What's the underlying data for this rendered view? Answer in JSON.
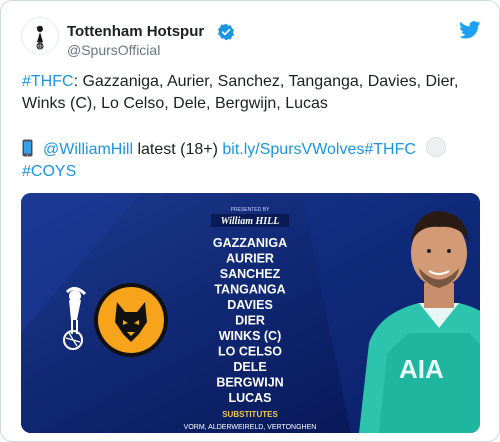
{
  "account": {
    "name": "Tottenham Hotspur",
    "handle": "@SpursOfficial"
  },
  "tweet": {
    "hashtag1": "#THFC",
    "text1": ": Gazzaniga, Aurier, Sanchez, Tanganga, Davies, Dier, Winks (C), Lo Celso, Dele, Bergwijn, Lucas",
    "mention": "@WilliamHill",
    "text2": " latest (18+) ",
    "url": "bit.ly/SpursVWolves",
    "hashtag2": "#THFC",
    "hashtag3": "#COYS"
  },
  "graphic": {
    "sponsor_small": "PRESENTED BY",
    "sponsor": "William HILL",
    "lineup": [
      "GAZZANIGA",
      "AURIER",
      "SANCHEZ",
      "TANGANGA",
      "DAVIES",
      "DIER",
      "WINKS (C)",
      "LO CELSO",
      "DELE",
      "BERGWIJN",
      "LUCAS"
    ],
    "subs_title": "SUBSTITUTES",
    "subs_partial": "VORM, ALDERWEIRELD, VERTONGHEN",
    "shirt_text": "AIA"
  },
  "colors": {
    "link": "#1b95e0",
    "graphic_bg": "#0b1f63",
    "wolves_orange": "#f7a31c",
    "keeper_green": "#1fb6a0"
  }
}
